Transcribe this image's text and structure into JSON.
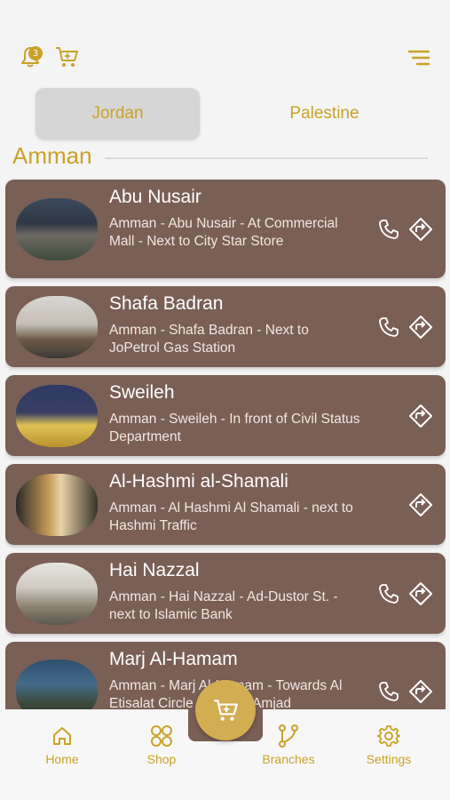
{
  "header": {
    "notification_count": "3",
    "icons": [
      "bell-icon",
      "cart-icon",
      "menu-icon"
    ]
  },
  "tabs": [
    {
      "label": "Jordan",
      "active": true
    },
    {
      "label": "Palestine",
      "active": false
    }
  ],
  "section": {
    "title": "Amman"
  },
  "branches": [
    {
      "name": "Abu Nusair",
      "address": "Amman - Abu Nusair - At Commercial Mall - Next to City Star Store",
      "has_phone": true
    },
    {
      "name": "Shafa Badran",
      "address": "Amman - Shafa Badran - Next to JoPetrol Gas Station",
      "has_phone": true
    },
    {
      "name": "Sweileh",
      "address": "Amman - Sweileh - In front of Civil Status Department",
      "has_phone": false
    },
    {
      "name": "Al-Hashmi al-Shamali",
      "address": "Amman - Al Hashmi Al Shamali - next to Hashmi Traffic",
      "has_phone": false
    },
    {
      "name": "Hai Nazzal",
      "address": "Amman - Hai Nazzal - Ad-Dustor St. - next to Islamic Bank",
      "has_phone": true
    },
    {
      "name": "Marj Al-Hamam",
      "address": "Amman - Marj Al-Hamam - Towards Al Etisalat Circle - Next to Amjad",
      "has_phone": true
    }
  ],
  "bottom_nav": [
    {
      "label": "Home",
      "icon": "home-icon"
    },
    {
      "label": "Shop",
      "icon": "grid-icon"
    },
    {
      "label": "Branches",
      "icon": "branch-icon",
      "active": true
    },
    {
      "label": "Settings",
      "icon": "gear-icon"
    }
  ],
  "colors": {
    "accent": "#c9a227",
    "card": "#7a5f55",
    "tab_active_bg": "#d6d6d6",
    "fab": "#d3ad52"
  }
}
